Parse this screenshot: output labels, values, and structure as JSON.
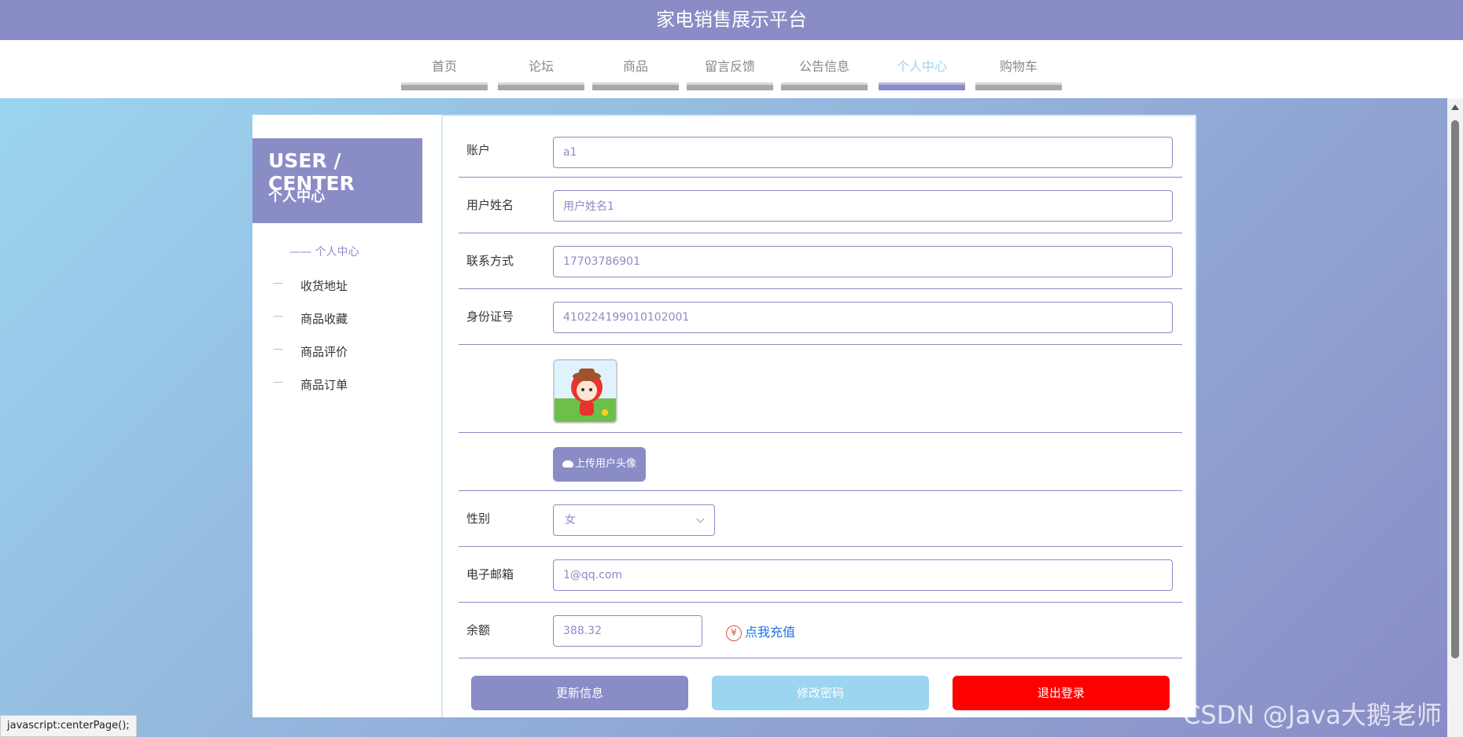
{
  "header": {
    "title": "家电销售展示平台"
  },
  "nav": [
    {
      "label": "首页"
    },
    {
      "label": "论坛"
    },
    {
      "label": "商品"
    },
    {
      "label": "留言反馈"
    },
    {
      "label": "公告信息"
    },
    {
      "label": "个人中心"
    },
    {
      "label": "购物车"
    }
  ],
  "sidebar": {
    "title_en": "USER / CENTER",
    "title_cn": "个人中心",
    "menu": [
      {
        "label": "—— 个人中心"
      },
      {
        "label": "收货地址"
      },
      {
        "label": "商品收藏"
      },
      {
        "label": "商品评价"
      },
      {
        "label": "商品订单"
      }
    ]
  },
  "form": {
    "account": {
      "label": "账户",
      "value": "a1"
    },
    "name": {
      "label": "用户姓名",
      "value": "用户姓名1"
    },
    "phone": {
      "label": "联系方式",
      "value": "17703786901"
    },
    "idcard": {
      "label": "身份证号",
      "value": "410224199010102001"
    },
    "upload_label": "上传用户头像",
    "gender": {
      "label": "性别",
      "value": "女"
    },
    "email": {
      "label": "电子邮箱",
      "value": "1@qq.com"
    },
    "balance": {
      "label": "余额",
      "value": "388.32",
      "recharge": "点我充值"
    }
  },
  "buttons": {
    "update": "更新信息",
    "password": "修改密码",
    "logout": "退出登录"
  },
  "status_bar": "javascript:centerPage();",
  "watermark": "CSDN @Java大鹅老师"
}
